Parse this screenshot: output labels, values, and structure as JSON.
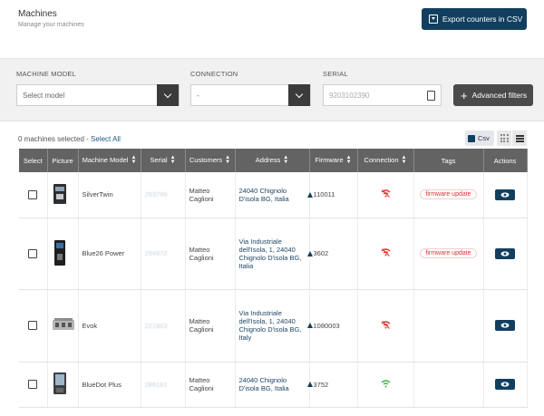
{
  "header": {
    "title": "Machines",
    "subtitle": "Manage your machines",
    "export_label": "Export counters in CSV"
  },
  "filters": {
    "model_label": "MACHINE MODEL",
    "model_placeholder": "Select model",
    "connection_label": "CONNECTION",
    "connection_value": "-",
    "serial_label": "SERIAL",
    "serial_placeholder": "9203102390",
    "advanced_label": "Advanced filters"
  },
  "selection": {
    "count_text": "0 machines selected - ",
    "select_all": "Select All"
  },
  "toolbar": {
    "csv_label": "Csv"
  },
  "table": {
    "headers": [
      "Select",
      "Picture",
      "Machine Model",
      "Serial",
      "Customers",
      "Address",
      "Firmware",
      "Connection",
      "Tags",
      "Actions"
    ],
    "rows": [
      {
        "model": "SilverTwin",
        "serial": "293799",
        "customer": "Matteo Caglioni",
        "address": "24040 Chignolo D'isola BG, Italia",
        "firmware": "110011",
        "connection": "disconnected",
        "tag": "firmware update"
      },
      {
        "model": "Blue26 Power",
        "serial": "294972",
        "customer": "Matteo Caglioni",
        "address": "Via Industriale dell'Isola, 1, 24040 Chignolo D'isola BG, Italia",
        "firmware": "3602",
        "connection": "disconnected",
        "tag": "firmware update"
      },
      {
        "model": "Evok",
        "serial": "221863",
        "customer": "Matteo Caglioni",
        "address": "Via Industriale dell'Isola, 1, 24040 Chignolo D'isola BG, Italy",
        "firmware": "1080003",
        "connection": "disconnected",
        "tag": ""
      },
      {
        "model": "BlueDot Plus",
        "serial": "286181",
        "customer": "Matteo Caglioni",
        "address": "24040 Chignolo D'isola BG, Italia",
        "firmware": "3752",
        "connection": "connected",
        "tag": ""
      }
    ]
  },
  "colors": {
    "primary": "#123f5f",
    "header_bg": "#636363",
    "tag_text": "#dd3333",
    "disconnected": "#e53935",
    "connected": "#4caf50"
  }
}
